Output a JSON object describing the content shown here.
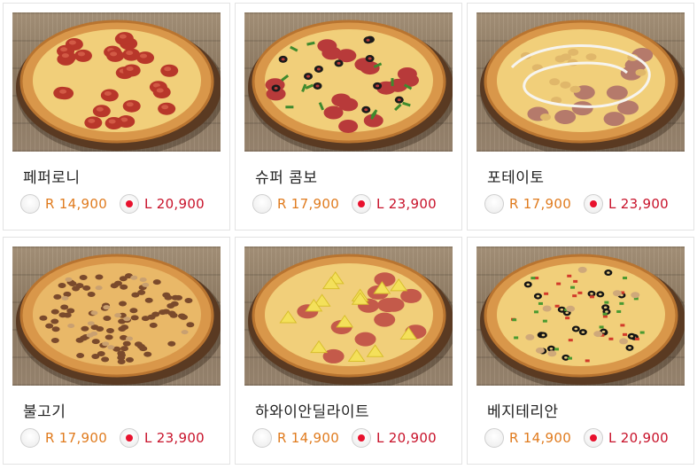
{
  "menu": {
    "items": [
      {
        "name": "페퍼로니",
        "topping": "pepperoni",
        "regular_price": "R 14,900",
        "large_price": "L 20,900",
        "selected": "large"
      },
      {
        "name": "슈퍼 콤보",
        "topping": "supreme",
        "regular_price": "R 17,900",
        "large_price": "L 23,900",
        "selected": "large"
      },
      {
        "name": "포테이토",
        "topping": "potato",
        "regular_price": "R 17,900",
        "large_price": "L 23,900",
        "selected": "large"
      },
      {
        "name": "불고기",
        "topping": "bulgogi",
        "regular_price": "R 17,900",
        "large_price": "L 23,900",
        "selected": "large"
      },
      {
        "name": "하와이안딜라이트",
        "topping": "hawaiian",
        "regular_price": "R 14,900",
        "large_price": "L 20,900",
        "selected": "large"
      },
      {
        "name": "베지테리안",
        "topping": "veggie",
        "regular_price": "R 14,900",
        "large_price": "L 20,900",
        "selected": "large"
      }
    ]
  },
  "colors": {
    "regular_price": "#e07b1e",
    "large_price": "#c8122a",
    "radio_dot": "#e8112d",
    "card_border": "#e3e3e3"
  }
}
